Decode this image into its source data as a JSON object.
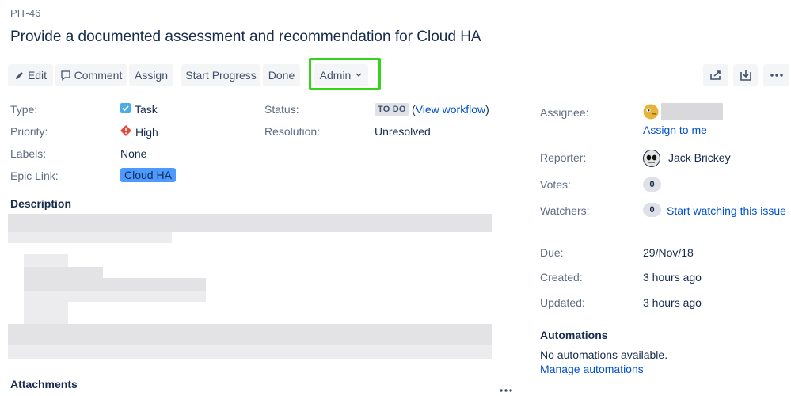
{
  "issue": {
    "key": "PIT-46",
    "title": "Provide a documented assessment and recommendation for Cloud HA"
  },
  "toolbar": {
    "edit": "Edit",
    "comment": "Comment",
    "assign": "Assign",
    "start_progress": "Start Progress",
    "done": "Done",
    "admin": "Admin"
  },
  "details": {
    "type_label": "Type:",
    "type_value": "Task",
    "priority_label": "Priority:",
    "priority_value": "High",
    "labels_label": "Labels:",
    "labels_value": "None",
    "epic_label": "Epic Link:",
    "epic_value": "Cloud HA",
    "status_label": "Status:",
    "status_value": "TO DO",
    "view_workflow_open": "(",
    "view_workflow": "View workflow",
    "view_workflow_close": ")",
    "resolution_label": "Resolution:",
    "resolution_value": "Unresolved"
  },
  "description": {
    "heading": "Description"
  },
  "attachments": {
    "heading": "Attachments"
  },
  "people": {
    "assignee_label": "Assignee:",
    "assign_to_me": "Assign to me",
    "reporter_label": "Reporter:",
    "reporter_name": "Jack Brickey",
    "votes_label": "Votes:",
    "votes_count": "0",
    "watchers_label": "Watchers:",
    "watchers_count": "0",
    "start_watching": "Start watching this issue"
  },
  "dates": {
    "due_label": "Due:",
    "due_value": "29/Nov/18",
    "created_label": "Created:",
    "created_value": "3 hours ago",
    "updated_label": "Updated:",
    "updated_value": "3 hours ago"
  },
  "automations": {
    "heading": "Automations",
    "empty_text": "No automations available.",
    "manage_link": "Manage automations"
  },
  "colors": {
    "accent": "#0052cc",
    "highlight": "#33d41a",
    "epic": "#4c9aff",
    "priority_high": "#e5493a",
    "task_icon": "#4bade8"
  },
  "icons": {
    "edit": "pencil-icon",
    "comment": "comment-icon",
    "admin_dropdown": "chevron-down-icon",
    "share": "share-icon",
    "export": "export-icon",
    "more": "more-icon",
    "task": "task-checkbox-icon",
    "priority": "priority-high-icon"
  }
}
